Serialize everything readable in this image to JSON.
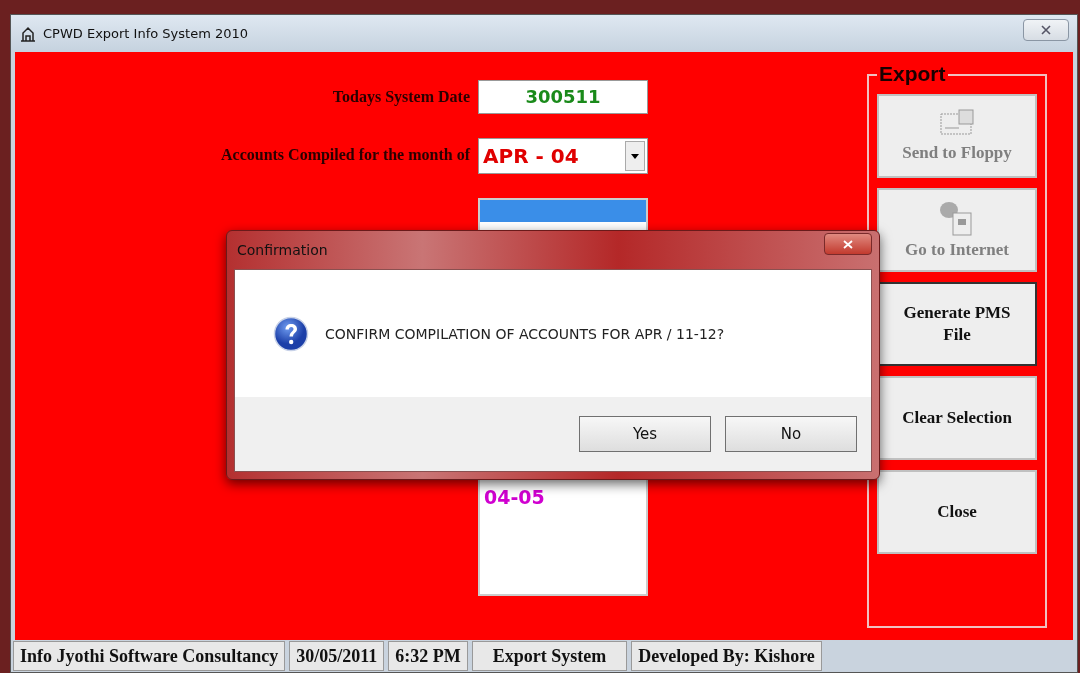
{
  "window": {
    "title": "CPWD Export Info System 2010"
  },
  "form": {
    "system_date": {
      "label": "Todays System Date",
      "value": "300511"
    },
    "month": {
      "label": "Accounts Compiled for the month of",
      "value": "APR - 04"
    },
    "year_list": [
      {
        "selected": true
      },
      {
        "label": "04-05",
        "selected": false
      }
    ]
  },
  "export_group": {
    "title": "Export",
    "buttons": [
      {
        "label": "Send to Floppy",
        "kind": "floppy",
        "disabled": true,
        "focused": false
      },
      {
        "label": "Go to Internet",
        "kind": "internet",
        "disabled": true,
        "focused": false
      },
      {
        "label": "Generate PMS File",
        "kind": "plain",
        "disabled": false,
        "focused": true
      },
      {
        "label": "Clear Selection",
        "kind": "plain",
        "disabled": false,
        "focused": false
      },
      {
        "label": "Close",
        "kind": "plain",
        "disabled": false,
        "focused": false
      }
    ]
  },
  "status_bar": [
    "Info Jyothi Software Consultancy",
    "30/05/2011",
    "6:32 PM",
    "Export System",
    "Developed By: Kishore"
  ],
  "dialog": {
    "title": "Confirmation",
    "message": "CONFIRM COMPILATION OF ACCOUNTS FOR APR / 11-12?",
    "buttons": [
      "Yes",
      "No"
    ]
  }
}
